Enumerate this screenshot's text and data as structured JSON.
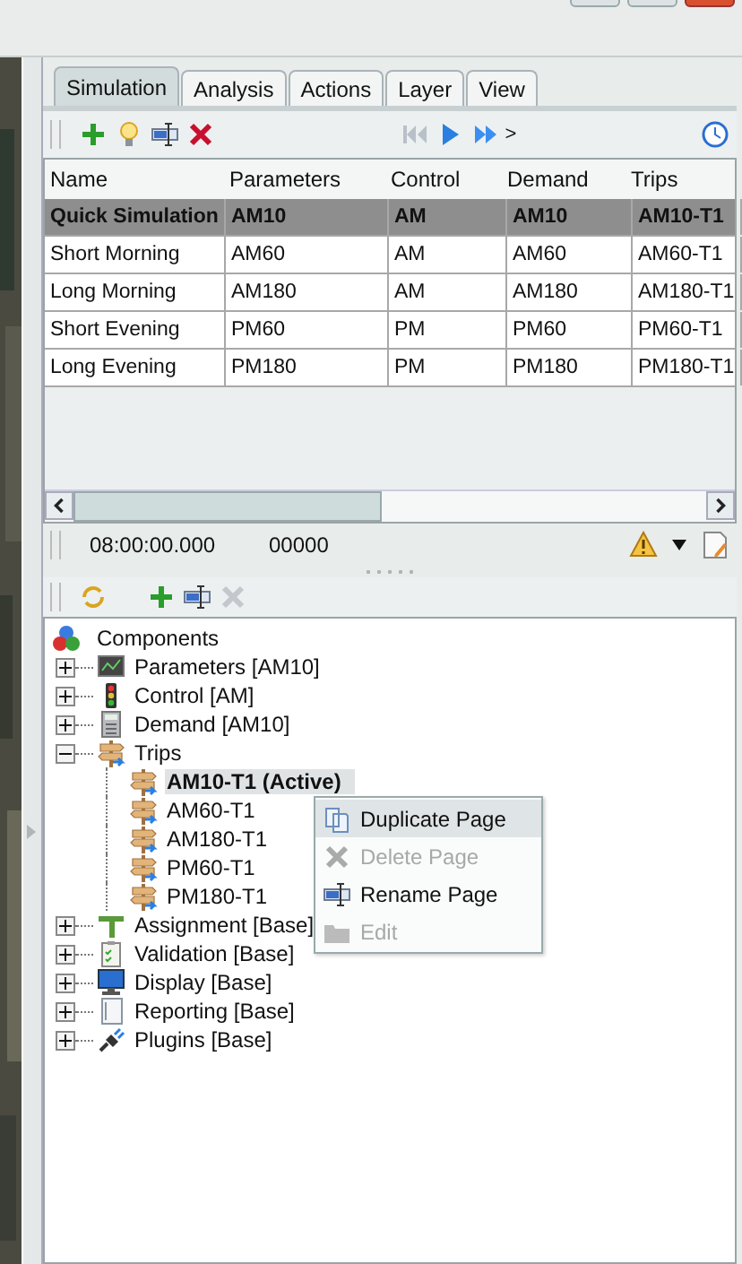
{
  "tabs": [
    {
      "label": "Simulation",
      "selected": true
    },
    {
      "label": "Analysis",
      "selected": false
    },
    {
      "label": "Actions",
      "selected": false
    },
    {
      "label": "Layer",
      "selected": false
    },
    {
      "label": "View",
      "selected": false
    }
  ],
  "toolbar": {
    "more": ">"
  },
  "table": {
    "columns": [
      "Name",
      "Parameters",
      "Control",
      "Demand",
      "Trips"
    ],
    "rows": [
      {
        "cells": [
          "Quick Simulation",
          "AM10",
          "AM",
          "AM10",
          "AM10-T1"
        ],
        "selected": true
      },
      {
        "cells": [
          "Short Morning",
          "AM60",
          "AM",
          "AM60",
          "AM60-T1"
        ],
        "selected": false
      },
      {
        "cells": [
          "Long Morning",
          "AM180",
          "AM",
          "AM180",
          "AM180-T1"
        ],
        "selected": false
      },
      {
        "cells": [
          "Short Evening",
          "PM60",
          "PM",
          "PM60",
          "PM60-T1"
        ],
        "selected": false
      },
      {
        "cells": [
          "Long Evening",
          "PM180",
          "PM",
          "PM180",
          "PM180-T1"
        ],
        "selected": false
      }
    ]
  },
  "status_bar": {
    "time": "08:00:00.000",
    "count": "00000"
  },
  "tree": {
    "label": "Components",
    "children": [
      {
        "label": "Parameters [AM10]",
        "expanded": false
      },
      {
        "label": "Control [AM]",
        "expanded": false
      },
      {
        "label": "Demand [AM10]",
        "expanded": false
      },
      {
        "label": "Trips",
        "expanded": true,
        "children": [
          {
            "label": "AM10-T1 (Active)",
            "active": true,
            "selected": true
          },
          {
            "label": "AM60-T1",
            "active": false,
            "selected": false
          },
          {
            "label": "AM180-T1",
            "active": false,
            "selected": false
          },
          {
            "label": "PM60-T1",
            "active": false,
            "selected": false
          },
          {
            "label": "PM180-T1",
            "active": false,
            "selected": false
          }
        ]
      },
      {
        "label": "Assignment [Base]",
        "expanded": false
      },
      {
        "label": "Validation [Base]",
        "expanded": false
      },
      {
        "label": "Display [Base]",
        "expanded": false
      },
      {
        "label": "Reporting [Base]",
        "expanded": false
      },
      {
        "label": "Plugins [Base]",
        "expanded": false
      }
    ]
  },
  "context_menu": [
    {
      "label": "Duplicate Page",
      "selected": true,
      "disabled": false
    },
    {
      "label": "Delete Page",
      "selected": false,
      "disabled": true
    },
    {
      "label": "Rename Page",
      "selected": false,
      "disabled": false
    },
    {
      "label": "Edit",
      "selected": false,
      "disabled": true
    }
  ]
}
